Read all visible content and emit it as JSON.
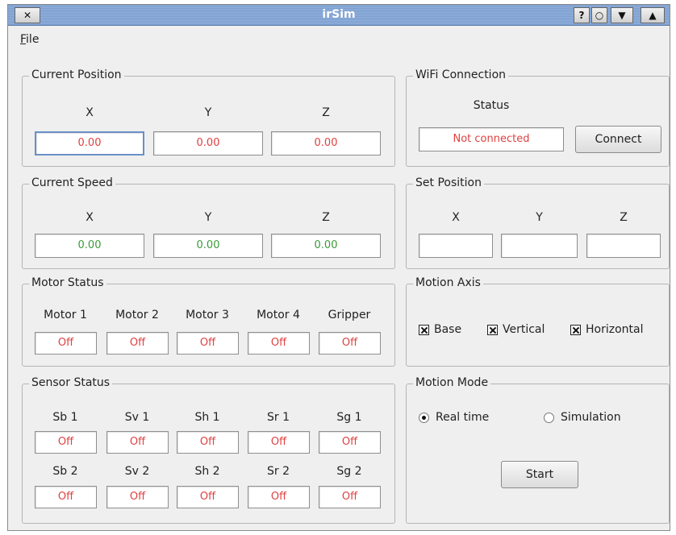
{
  "window": {
    "title": "irSim",
    "close_glyph": "✕",
    "help_glyph": "?",
    "shade_glyph": "○",
    "minimize_glyph": "▼",
    "maximize_glyph": "▲"
  },
  "menu": {
    "file_mnemonic": "F",
    "file_rest": "ile"
  },
  "current_position": {
    "title": "Current Position",
    "labels": [
      "X",
      "Y",
      "Z"
    ],
    "values": [
      "0.00",
      "0.00",
      "0.00"
    ]
  },
  "current_speed": {
    "title": "Current Speed",
    "labels": [
      "X",
      "Y",
      "Z"
    ],
    "values": [
      "0.00",
      "0.00",
      "0.00"
    ]
  },
  "motor_status": {
    "title": "Motor Status",
    "labels": [
      "Motor 1",
      "Motor 2",
      "Motor 3",
      "Motor 4",
      "Gripper"
    ],
    "values": [
      "Off",
      "Off",
      "Off",
      "Off",
      "Off"
    ]
  },
  "sensor_status": {
    "title": "Sensor Status",
    "row1_labels": [
      "Sb 1",
      "Sv 1",
      "Sh 1",
      "Sr 1",
      "Sg 1"
    ],
    "row1_values": [
      "Off",
      "Off",
      "Off",
      "Off",
      "Off"
    ],
    "row2_labels": [
      "Sb 2",
      "Sv 2",
      "Sh 2",
      "Sr 2",
      "Sg 2"
    ],
    "row2_values": [
      "Off",
      "Off",
      "Off",
      "Off",
      "Off"
    ]
  },
  "wifi": {
    "title": "WiFi Connection",
    "status_label": "Status",
    "status_value": "Not connected",
    "connect_label": "Connect"
  },
  "set_position": {
    "title": "Set Position",
    "labels": [
      "X",
      "Y",
      "Z"
    ],
    "values": [
      "",
      "",
      ""
    ]
  },
  "motion_axis": {
    "title": "Motion Axis",
    "options": [
      {
        "label": "Base",
        "checked": true
      },
      {
        "label": "Vertical",
        "checked": true
      },
      {
        "label": "Horizontal",
        "checked": true
      }
    ]
  },
  "motion_mode": {
    "title": "Motion Mode",
    "options": [
      {
        "label": "Real time",
        "selected": true
      },
      {
        "label": "Simulation",
        "selected": false
      }
    ],
    "start_label": "Start"
  },
  "colors": {
    "titlebar": "#86a8d6",
    "status_off": "#e04040",
    "speed_value": "#3a9a3a",
    "focus_border": "#6a8fc8"
  }
}
